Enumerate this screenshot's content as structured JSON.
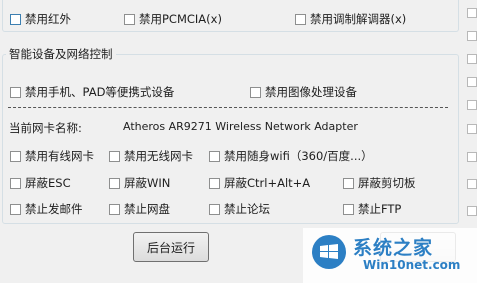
{
  "top_row": {
    "disable_infrared": "禁用红外",
    "disable_pcmcia": "禁用PCMCIA(x)",
    "disable_modem": "禁用调制解调器(x)"
  },
  "smart_devices": {
    "title": "智能设备及网络控制",
    "disable_portable": "禁用手机、PAD等便携式设备",
    "disable_imaging": "禁用图像处理设备"
  },
  "network": {
    "adapter_label": "当前网卡名称:",
    "adapter_name": "Atheros AR9271 Wireless Network Adapter",
    "disable_wired": "禁用有线网卡",
    "disable_wireless": "禁用无线网卡",
    "disable_portable_wifi": "禁用随身wifi（360/百度...）",
    "block_esc": "屏蔽ESC",
    "block_win": "屏蔽WIN",
    "block_ctrl_alt_a": "屏蔽Ctrl+Alt+A",
    "block_clipboard": "屏蔽剪切板",
    "no_email": "禁止发邮件",
    "no_netdisk": "禁止网盘",
    "no_forum": "禁止论坛",
    "no_ftp": "禁止FTP"
  },
  "buttons": {
    "background_run": "后台运行"
  },
  "watermark": {
    "title": "系统之家",
    "url": "Win10net.com"
  }
}
